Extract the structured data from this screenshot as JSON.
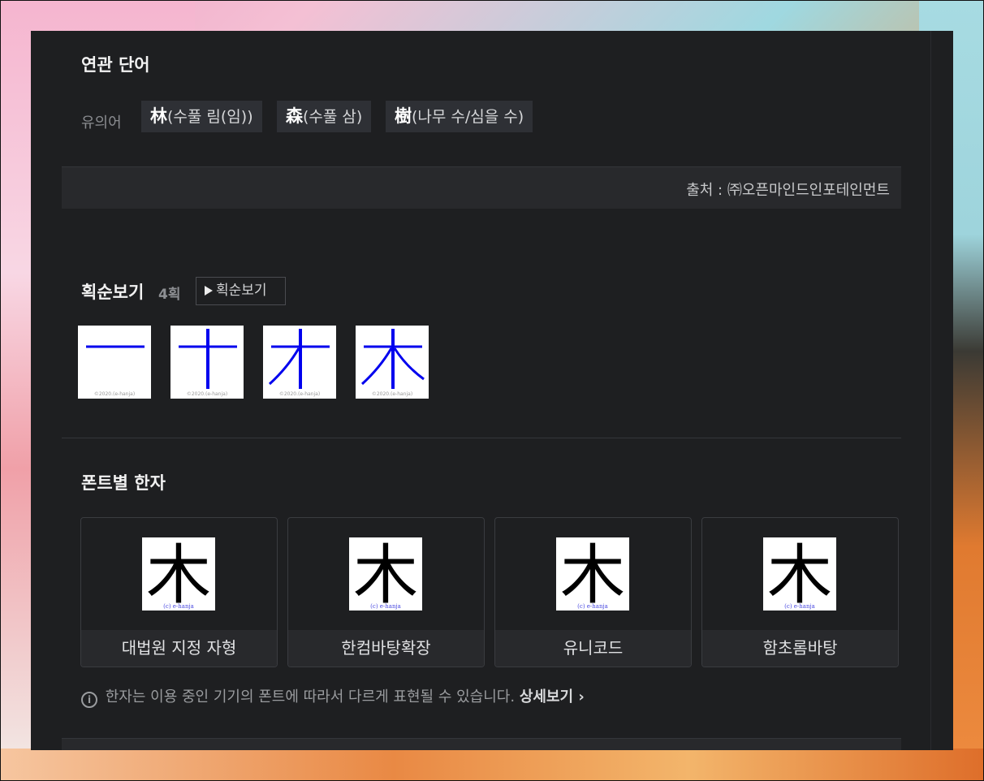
{
  "related": {
    "title": "연관 단어",
    "synonym_label": "유의어",
    "synonyms": [
      {
        "hanja": "林",
        "reading": "(수풀 림(임))"
      },
      {
        "hanja": "森",
        "reading": "(수풀 삼)"
      },
      {
        "hanja": "樹",
        "reading": "(나무 수/심을 수)"
      }
    ],
    "source": "출처 : ㈜오픈마인드인포테인먼트"
  },
  "strokes": {
    "title": "획순보기",
    "count": "4획",
    "play_label": "획순보기",
    "watermark": "©2020.(e-hanja)",
    "stroke_color": "#0000ee"
  },
  "fonts": {
    "title": "폰트별 한자",
    "character": "木",
    "watermark": "(c) e-hanja",
    "cards": [
      {
        "label": "대법원 지정 자형"
      },
      {
        "label": "한컴바탕확장"
      },
      {
        "label": "유니코드"
      },
      {
        "label": "함초롬바탕"
      }
    ],
    "notice": "한자는 이용 중인 기기의 폰트에 따라서 다르게 표현될 수 있습니다.",
    "detail_link": "상세보기",
    "info_icon": "info-icon",
    "chevron_icon": "chevron-right-icon"
  }
}
